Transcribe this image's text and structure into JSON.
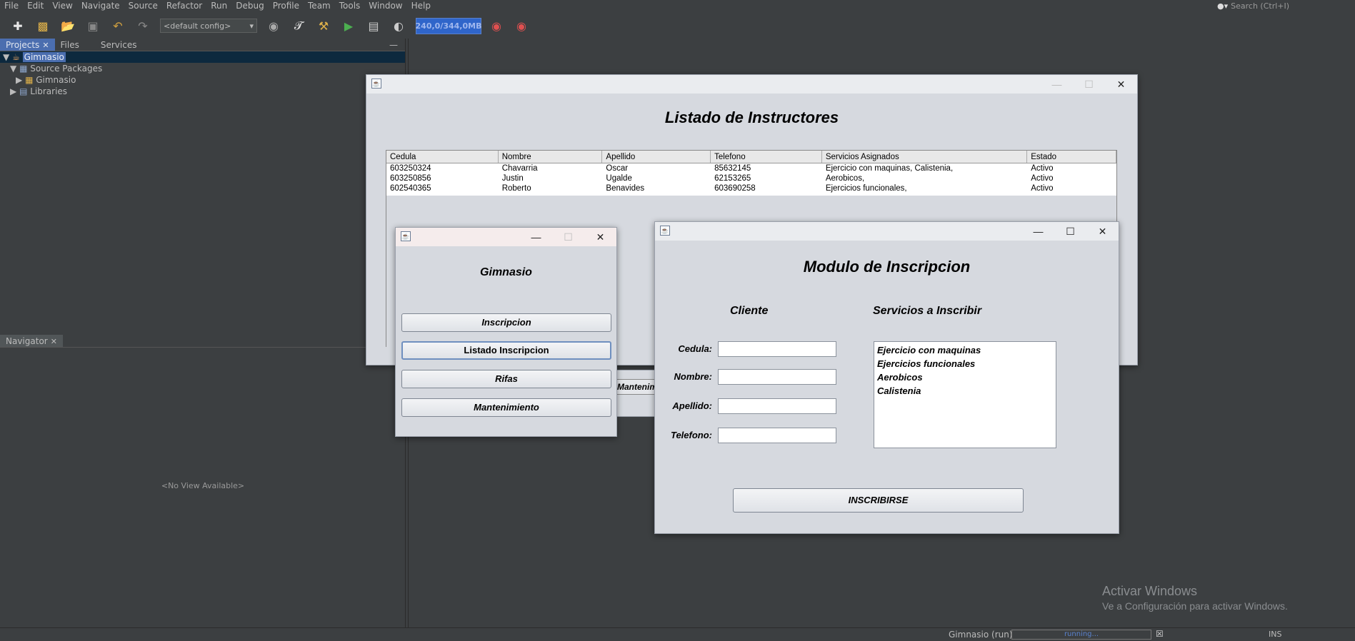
{
  "menubar": {
    "items": [
      "File",
      "Edit",
      "View",
      "Navigate",
      "Source",
      "Refactor",
      "Run",
      "Debug",
      "Profile",
      "Team",
      "Tools",
      "Window",
      "Help"
    ],
    "search_placeholder": "Search (Ctrl+I)"
  },
  "toolbar": {
    "config": "<default config>",
    "memory": "240,0/344,0MB"
  },
  "projects_panel": {
    "tabs": [
      "Projects",
      "Files",
      "Services"
    ],
    "tree": [
      {
        "label": "Gimnasio",
        "level": 0,
        "expanded": true,
        "selected": true
      },
      {
        "label": "Source Packages",
        "level": 1,
        "expanded": true
      },
      {
        "label": "Gimnasio",
        "level": 2,
        "expanded": false
      },
      {
        "label": "Libraries",
        "level": 1,
        "expanded": false
      }
    ]
  },
  "navigator_panel": {
    "tab": "Navigator",
    "empty_text": "<No View Available>"
  },
  "instructor_window": {
    "title": "Listado de Instructores",
    "columns": [
      "Cedula",
      "Nombre",
      "Apellido",
      "Telefono",
      "Servicios Asignados",
      "Estado"
    ],
    "rows": [
      [
        "603250324",
        "Chavarria",
        "Oscar",
        "85632145",
        "Ejercicio con maquinas, Calistenia,",
        "Activo"
      ],
      [
        "603250856",
        "Justin",
        "Ugalde",
        "62153265",
        "Aerobicos,",
        "Activo"
      ],
      [
        "602540365",
        "Roberto",
        "Benavides",
        "603690258",
        "Ejercicios funcionales,",
        "Activo"
      ]
    ]
  },
  "hidden_window": {
    "button_partial": "Mantenimi"
  },
  "menu_window": {
    "title": "Gimnasio",
    "buttons": [
      "Inscripcion",
      "Listado Inscripcion",
      "Rifas",
      "Mantenimiento"
    ]
  },
  "inscripcion_window": {
    "title": "Modulo de Inscripcion",
    "cliente_heading": "Cliente",
    "servicios_heading": "Servicios a Inscribir",
    "fields": {
      "cedula": {
        "label": "Cedula:",
        "value": ""
      },
      "nombre": {
        "label": "Nombre:",
        "value": ""
      },
      "apellido": {
        "label": "Apellido:",
        "value": ""
      },
      "telefono": {
        "label": "Telefono:",
        "value": ""
      }
    },
    "services": [
      "Ejercicio con maquinas",
      "Ejercicios funcionales",
      "Aerobicos",
      "Calistenia"
    ],
    "submit_label": "INSCRIBIRSE"
  },
  "statusbar": {
    "task": "Gimnasio (run)",
    "progress": "running...",
    "mode": "INS"
  },
  "watermark": {
    "line1": "Activar Windows",
    "line2": "Ve a Configuración para activar Windows."
  },
  "colors": {
    "ide_bg": "#3c3f41",
    "selection": "#4b6eaf",
    "swing_bg": "#d6d9df"
  }
}
